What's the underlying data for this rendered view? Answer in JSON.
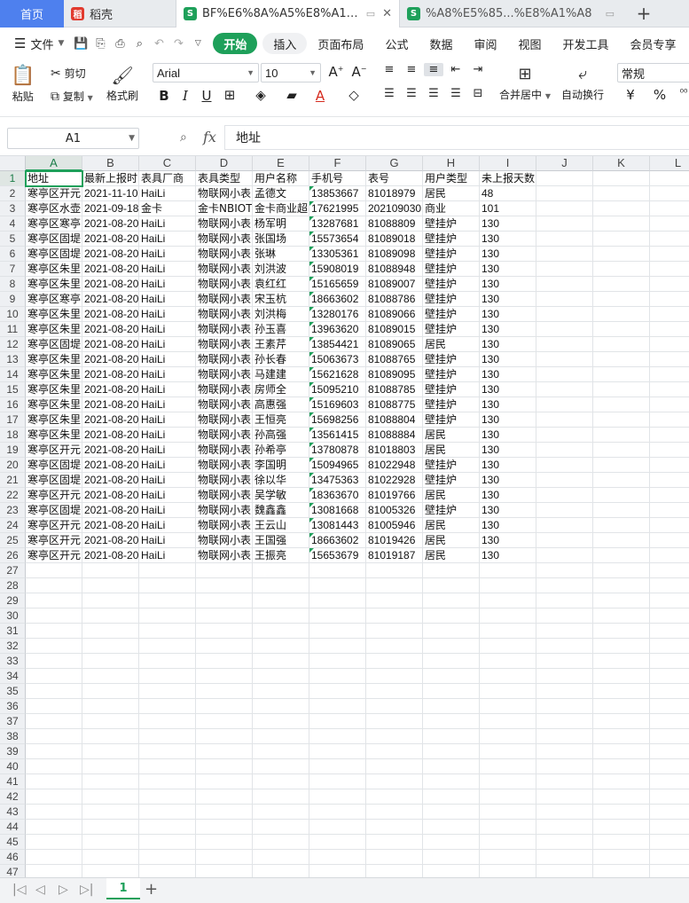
{
  "tabs": [
    {
      "label": "首页",
      "kind": "home"
    },
    {
      "label": "稻壳",
      "kind": "docer",
      "icon": "docer-icon"
    },
    {
      "label": "BF%E6%8A%A5%E8%A1%A8",
      "kind": "active",
      "icon": "sheet-icon"
    },
    {
      "label": "%A8%E5%85...%E8%A1%A8",
      "kind": "other",
      "icon": "sheet-icon"
    }
  ],
  "tab_icons": {
    "docer": "稻",
    "sheet": "S"
  },
  "menu": {
    "file_label": "文件",
    "tabs": [
      "开始",
      "插入",
      "页面布局",
      "公式",
      "数据",
      "审阅",
      "视图",
      "开发工具",
      "会员专享"
    ]
  },
  "ribbon": {
    "paste": "粘贴",
    "cut": "剪切",
    "copy": "复制",
    "format_painter": "格式刷",
    "font_name": "Arial",
    "font_size": "10",
    "merge": "合并居中",
    "wrap": "自动换行",
    "number_format": "常规",
    "currency_symbol": "¥",
    "percent_symbol": "%"
  },
  "formula_bar": {
    "cell_ref": "A1",
    "fx": "fx",
    "content": "地址"
  },
  "columns": [
    "A",
    "B",
    "C",
    "D",
    "E",
    "F",
    "G",
    "H",
    "I",
    "J",
    "K",
    "L"
  ],
  "rows": [
    [
      "地址",
      "最新上报时",
      "表具厂商",
      "表具类型",
      "用户名称",
      "手机号",
      "表号",
      "用户类型",
      "未上报天数"
    ],
    [
      "寒亭区开元",
      "2021-11-10",
      "HaiLi",
      "物联网小表",
      "孟德文",
      "13853667",
      "81018979",
      "居民",
      "48"
    ],
    [
      "寒亭区水壶",
      "2021-09-18",
      "金卡",
      "金卡NBIOT",
      "金卡商业超",
      "17621995",
      "202109030",
      "商业",
      "101"
    ],
    [
      "寒亭区寒亭",
      "2021-08-20",
      "HaiLi",
      "物联网小表",
      "杨军明",
      "13287681",
      "81088809",
      "壁挂炉",
      "130"
    ],
    [
      "寒亭区固堤",
      "2021-08-20",
      "HaiLi",
      "物联网小表",
      "张国场",
      "15573654",
      "81089018",
      "壁挂炉",
      "130"
    ],
    [
      "寒亭区固堤",
      "2021-08-20",
      "HaiLi",
      "物联网小表",
      "张琳",
      "13305361",
      "81089098",
      "壁挂炉",
      "130"
    ],
    [
      "寒亭区朱里",
      "2021-08-20",
      "HaiLi",
      "物联网小表",
      "刘洪波",
      "15908019",
      "81088948",
      "壁挂炉",
      "130"
    ],
    [
      "寒亭区朱里",
      "2021-08-20",
      "HaiLi",
      "物联网小表",
      "袁红红",
      "15165659",
      "81089007",
      "壁挂炉",
      "130"
    ],
    [
      "寒亭区寒亭",
      "2021-08-20",
      "HaiLi",
      "物联网小表",
      "宋玉杭",
      "18663602",
      "81088786",
      "壁挂炉",
      "130"
    ],
    [
      "寒亭区朱里",
      "2021-08-20",
      "HaiLi",
      "物联网小表",
      "刘洪梅",
      "13280176",
      "81089066",
      "壁挂炉",
      "130"
    ],
    [
      "寒亭区朱里",
      "2021-08-20",
      "HaiLi",
      "物联网小表",
      "孙玉喜",
      "13963620",
      "81089015",
      "壁挂炉",
      "130"
    ],
    [
      "寒亭区固堤",
      "2021-08-20",
      "HaiLi",
      "物联网小表",
      "王素芹",
      "13854421",
      "81089065",
      "居民",
      "130"
    ],
    [
      "寒亭区朱里",
      "2021-08-20",
      "HaiLi",
      "物联网小表",
      "孙长春",
      "15063673",
      "81088765",
      "壁挂炉",
      "130"
    ],
    [
      "寒亭区朱里",
      "2021-08-20",
      "HaiLi",
      "物联网小表",
      "马建建",
      "15621628",
      "81089095",
      "壁挂炉",
      "130"
    ],
    [
      "寒亭区朱里",
      "2021-08-20",
      "HaiLi",
      "物联网小表",
      "房师全",
      "15095210",
      "81088785",
      "壁挂炉",
      "130"
    ],
    [
      "寒亭区朱里",
      "2021-08-20",
      "HaiLi",
      "物联网小表",
      "高惠强",
      "15169603",
      "81088775",
      "壁挂炉",
      "130"
    ],
    [
      "寒亭区朱里",
      "2021-08-20",
      "HaiLi",
      "物联网小表",
      "王恒亮",
      "15698256",
      "81088804",
      "壁挂炉",
      "130"
    ],
    [
      "寒亭区朱里",
      "2021-08-20",
      "HaiLi",
      "物联网小表",
      "孙高强",
      "13561415",
      "81088884",
      "居民",
      "130"
    ],
    [
      "寒亭区开元",
      "2021-08-20",
      "HaiLi",
      "物联网小表",
      "孙希亭",
      "13780878",
      "81018803",
      "居民",
      "130"
    ],
    [
      "寒亭区固堤",
      "2021-08-20",
      "HaiLi",
      "物联网小表",
      "李国明",
      "15094965",
      "81022948",
      "壁挂炉",
      "130"
    ],
    [
      "寒亭区固堤",
      "2021-08-20",
      "HaiLi",
      "物联网小表",
      "徐以华",
      "13475363",
      "81022928",
      "壁挂炉",
      "130"
    ],
    [
      "寒亭区开元",
      "2021-08-20",
      "HaiLi",
      "物联网小表",
      "吴学敏",
      "18363670",
      "81019766",
      "居民",
      "130"
    ],
    [
      "寒亭区固堤",
      "2021-08-20",
      "HaiLi",
      "物联网小表",
      "魏鑫鑫",
      "13081668",
      "81005326",
      "壁挂炉",
      "130"
    ],
    [
      "寒亭区开元",
      "2021-08-20",
      "HaiLi",
      "物联网小表",
      "王云山",
      "13081443",
      "81005946",
      "居民",
      "130"
    ],
    [
      "寒亭区开元",
      "2021-08-20",
      "HaiLi",
      "物联网小表",
      "王国强",
      "18663602",
      "81019426",
      "居民",
      "130"
    ],
    [
      "寒亭区开元",
      "2021-08-20",
      "HaiLi",
      "物联网小表",
      "王振亮",
      "15653679",
      "81019187",
      "居民",
      "130"
    ]
  ],
  "row_count_visible": 47,
  "selected_cell": "A1",
  "sheets": [
    "1"
  ],
  "colors": {
    "accent": "#1ea05a",
    "home_tab": "#4e80ee"
  }
}
